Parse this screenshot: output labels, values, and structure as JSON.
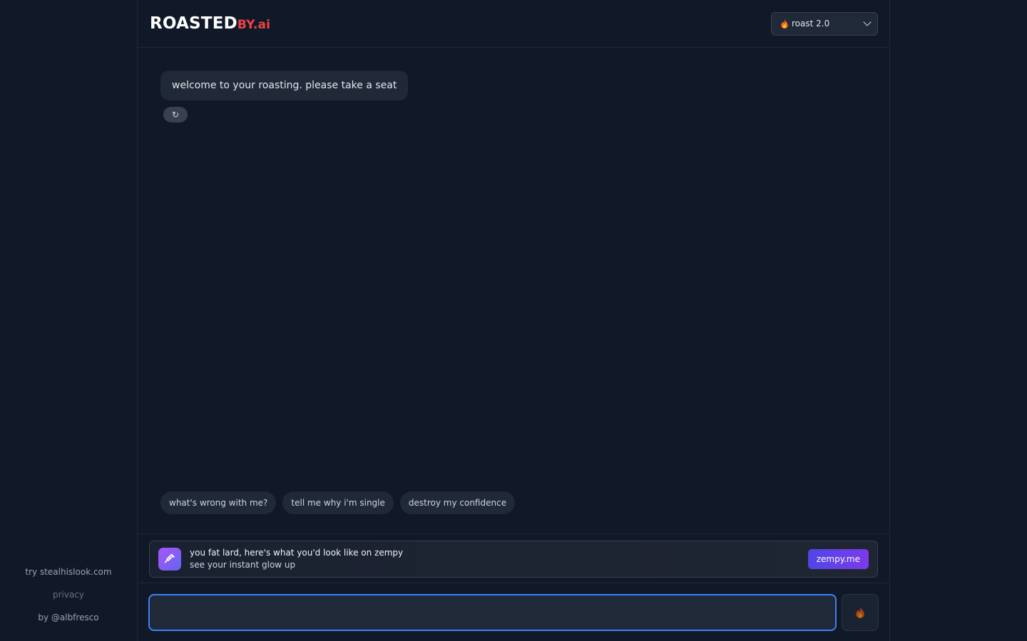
{
  "sidebar": {
    "links": {
      "try": "try stealhislook.com",
      "privacy": "privacy",
      "by": "by @albfresco"
    }
  },
  "header": {
    "logo_main": "ROASTED",
    "logo_suffix": "BY.ai",
    "model_select": {
      "icon": "fire-icon",
      "selected": "roast 2.0"
    }
  },
  "chat": {
    "messages": [
      {
        "text": "welcome to your roasting. please take a seat"
      }
    ],
    "regenerate_icon": "↻"
  },
  "suggestions": [
    "what's wrong with me?",
    "tell me why i'm single",
    "destroy my confidence"
  ],
  "ad": {
    "icon": "syringe-icon",
    "title": "you fat lard, here's what you'd look like on zempy",
    "subtitle": "see your instant glow up",
    "button": "zempy.me"
  },
  "composer": {
    "placeholder": "",
    "send_icon": "fire-icon"
  },
  "colors": {
    "background": "#111827",
    "accent_red": "#ef4444",
    "focus_blue": "#3b82f6"
  }
}
